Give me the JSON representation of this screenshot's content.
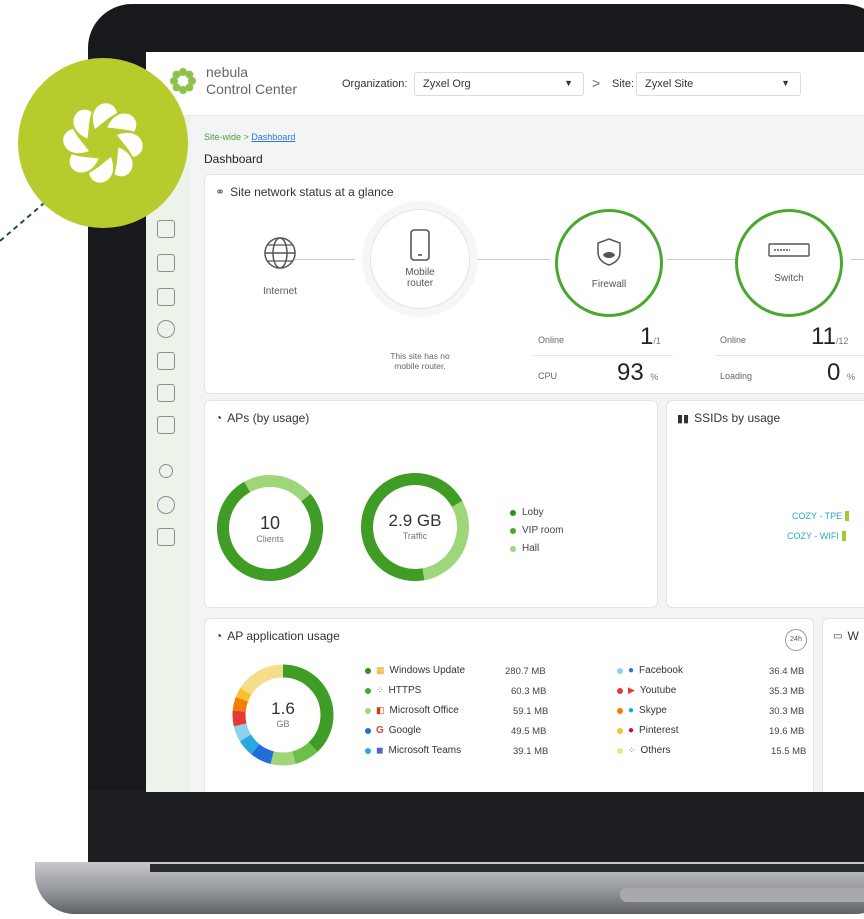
{
  "colors": {
    "accent": "#4aa82e",
    "dark_green": "#2f8f1f",
    "light_green": "#9fd67a",
    "badge": "#b8cb2d",
    "link": "#2a7bd8"
  },
  "header": {
    "brand_line1": "nebula",
    "brand_line2": "Control Center",
    "org_label": "Organization:",
    "org_value": "Zyxel Org",
    "site_label": "Site:",
    "site_value": "Zyxel Site"
  },
  "sidebar": {
    "icons": [
      "server-icon",
      "device-add-icon",
      "monitor-icon",
      "pie-chart-icon",
      "report-icon",
      "trend-chart-icon",
      "settings-list-icon",
      "key-icon",
      "help-icon",
      "building-icon"
    ]
  },
  "breadcrumb": {
    "prefix": "Site-wide >",
    "link": "Dashboard"
  },
  "page_title": "Dashboard",
  "network": {
    "title": "Site network status at a glance",
    "internet": "Internet",
    "mobile_router": "Mobile\nrouter",
    "mobile_router_note": "This site has no\nmobile router.",
    "firewall": "Firewall",
    "switch": "Switch",
    "fw_online_label": "Online",
    "fw_online_value": "1",
    "fw_online_total": "/1",
    "fw_cpu_label": "CPU",
    "fw_cpu_value": "93",
    "fw_cpu_unit": "%",
    "sw_online_label": "Online",
    "sw_online_value": "11",
    "sw_online_total": "/12",
    "sw_loading_label": "Loading",
    "sw_loading_value": "0",
    "sw_loading_unit": "%"
  },
  "aps": {
    "title": "APs (by usage)",
    "clients_value": "10",
    "clients_label": "Clients",
    "traffic_value": "2.9 GB",
    "traffic_label": "Traffic",
    "legend": [
      "Loby",
      "VIP room",
      "Hall"
    ]
  },
  "ssids": {
    "title": "SSIDs by usage",
    "items": [
      "COZY - TPE",
      "COZY - WIFI"
    ]
  },
  "apps": {
    "title": "AP application usage",
    "badge": "24h",
    "total_value": "1.6",
    "total_unit": "GB",
    "left": [
      {
        "name": "Windows Update",
        "value": "280.7 MB"
      },
      {
        "name": "HTTPS",
        "value": "60.3 MB"
      },
      {
        "name": "Microsoft Office",
        "value": "59.1 MB"
      },
      {
        "name": "Google",
        "value": "49.5 MB"
      },
      {
        "name": "Microsoft Teams",
        "value": "39.1 MB"
      }
    ],
    "right": [
      {
        "name": "Facebook",
        "value": "36.4 MB"
      },
      {
        "name": "Youtube",
        "value": "35.3 MB"
      },
      {
        "name": "Skype",
        "value": "30.3 MB"
      },
      {
        "name": "Pinterest",
        "value": "19.6 MB"
      },
      {
        "name": "Others",
        "value": "15.5 MB"
      }
    ]
  },
  "partial_card_label": "W"
}
